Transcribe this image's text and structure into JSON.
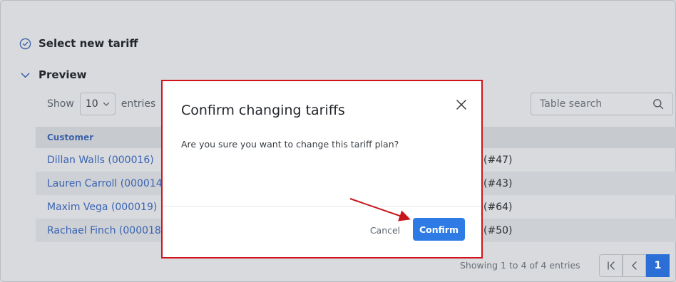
{
  "sections": {
    "select_tariff": "Select new tariff",
    "preview": "Preview"
  },
  "table_controls": {
    "show_label": "Show",
    "entries_value": "10",
    "entries_label": "entries",
    "search_placeholder": "Table search"
  },
  "table": {
    "columns": [
      "Customer"
    ],
    "rows": [
      {
        "customer": "Dillan Walls (000016)",
        "plan_suffix": "(#47)"
      },
      {
        "customer": "Lauren Carroll (000014)",
        "plan_suffix": "(#43)"
      },
      {
        "customer": "Maxim Vega (000019)",
        "plan_suffix": "(#64)"
      },
      {
        "customer": "Rachael Finch (000018)",
        "plan_suffix": "(#50)"
      }
    ]
  },
  "footer": {
    "info": "Showing 1 to 4 of 4 entries",
    "current_page": "1"
  },
  "modal": {
    "title": "Confirm changing tariffs",
    "body": "Are you sure you want to change this tariff plan?",
    "cancel_label": "Cancel",
    "confirm_label": "Confirm"
  },
  "colors": {
    "accent": "#2f7be6",
    "highlight_border": "#d1141b",
    "link": "#3a64b3"
  },
  "icons": [
    "check-circle-icon",
    "chevron-down-icon",
    "search-icon",
    "close-icon",
    "first-page-icon",
    "prev-page-icon"
  ]
}
